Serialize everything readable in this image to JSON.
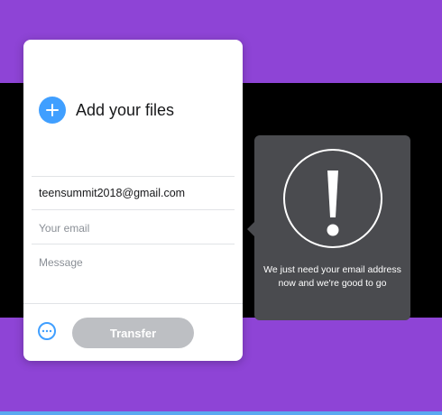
{
  "upload_panel": {
    "add_files_label": "Add your files",
    "add_icon": "plus-icon",
    "recipient_email": "teensummit2018@gmail.com",
    "your_email_placeholder": "Your email",
    "message_placeholder": "Message",
    "more_icon": "more-options-icon",
    "transfer_label": "Transfer"
  },
  "tooltip": {
    "icon": "exclamation-icon",
    "message": "We just need your email address now and we're good to go"
  },
  "colors": {
    "background_purple": "#8e44d6",
    "accent_blue": "#409fff",
    "button_disabled": "#bdbfc3",
    "tooltip_bg": "#4a4b4f"
  }
}
